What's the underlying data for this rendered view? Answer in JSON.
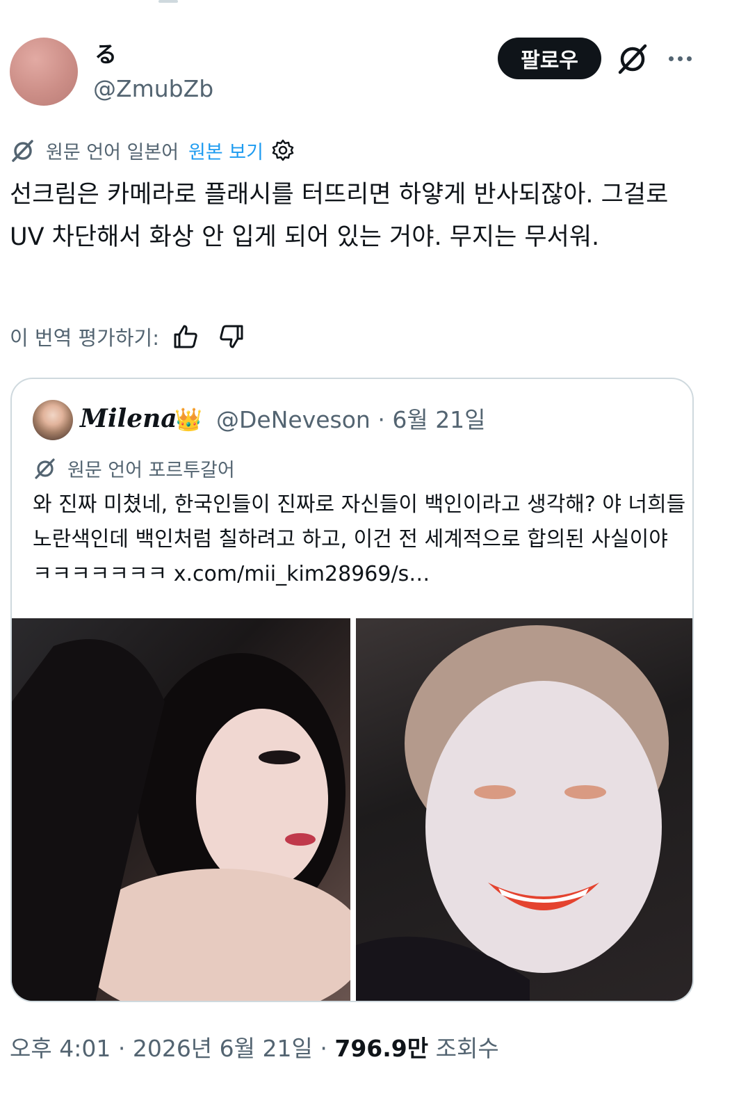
{
  "post": {
    "author_name": "る",
    "author_handle": "@ZmubZb",
    "follow_label": "팔로우",
    "translation_source": "원문 언어 일본어",
    "show_original_label": "원본 보기",
    "text": "선크림은 카메라로 플래시를 터뜨리면 하얗게 반사되잖아. 그걸로 UV 차단해서 화상 안 입게 되어 있는 거야. 무지는 무서워.",
    "rate_prompt": "이 번역 평가하기:"
  },
  "quoted": {
    "author_name": "Milena",
    "author_handle": "@DeNeveson",
    "meta_separator": "·",
    "date": "6월 21일",
    "translation_source": "원문 언어 포르투갈어",
    "text": "와 진짜 미쳤네, 한국인들이 진짜로 자신들이 백인이라고 생각해? 야 너희들 노란색인데 백인처럼 칠하려고 하고, 이건 전 세계적으로 합의된 사실이야 ㅋㅋㅋㅋㅋㅋㅋ x.com/mii_kim28969/s…",
    "crown_emoji": "👑"
  },
  "footer": {
    "time": "오후 4:01",
    "separator": "·",
    "date": "2026년 6월 21일",
    "views_count": "796.9만",
    "views_label": "조회수"
  },
  "icons": {
    "grok": "grok-icon",
    "more": "more-dots-icon",
    "settings": "gear-icon",
    "thumb_up": "thumbs-up-icon",
    "thumb_down": "thumbs-down-icon"
  },
  "colors": {
    "text_primary": "#0f1419",
    "text_secondary": "#536471",
    "link": "#1d9bf0",
    "border": "#cfd9de",
    "follow_bg": "#0f1419"
  }
}
